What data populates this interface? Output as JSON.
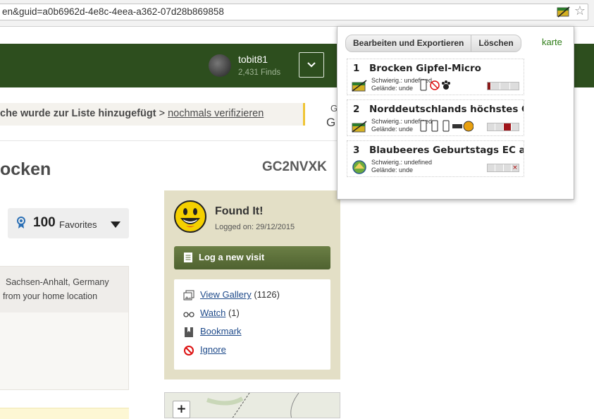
{
  "browser": {
    "url": "en&guid=a0b6962d-4e8c-4eea-a362-07d28b869858"
  },
  "header": {
    "username": "tobit81",
    "finds": "2,431 Finds"
  },
  "notice": {
    "text": "che wurde zur Liste hinzugefügt",
    "separator": " > ",
    "link": "nochmals verifizieren"
  },
  "fragments": {
    "g1": "G",
    "g2": "G"
  },
  "cache": {
    "title": "ocken",
    "code": "GC2NVXK"
  },
  "favorites": {
    "count": "100",
    "label": "Favorites"
  },
  "location": {
    "line1": "Sachsen-Anhalt, Germany",
    "line2": "from your home location"
  },
  "log": {
    "status": "Found It!",
    "logged_on": "Logged on: 29/12/2015",
    "log_button": "Log a new visit",
    "actions": [
      {
        "label": "View Gallery",
        "suffix": " (1126)",
        "icon": "gallery-icon"
      },
      {
        "label": "Watch",
        "suffix": " (1)",
        "icon": "glasses-icon"
      },
      {
        "label": "Bookmark",
        "suffix": "",
        "icon": "bookmark-icon"
      },
      {
        "label": "Ignore",
        "suffix": "",
        "icon": "ignore-icon"
      }
    ]
  },
  "map": {
    "zoom_in": "+"
  },
  "popup": {
    "buttons": [
      "Bearbeiten und Exportieren",
      "Löschen"
    ],
    "map_link": "karte",
    "items": [
      {
        "num": "1",
        "name": "Brocken Gipfel-Micro",
        "difficulty": "Schwierig.: undefined",
        "terrain": "Gelände: unde",
        "type": "traditional",
        "bar_state": "low",
        "bar_color": "#8b1a1a"
      },
      {
        "num": "2",
        "name": "Norddeutschlands höchstes Gip",
        "difficulty": "Schwierig.: undefined",
        "terrain": "Gelände: unde",
        "type": "traditional",
        "bar_state": "high",
        "bar_color": "#a0151a"
      },
      {
        "num": "3",
        "name": "Blaubeeres Geburtstags EC am I",
        "difficulty": "Schwierig.: undefined",
        "terrain": "Gelände: unde",
        "type": "earthcache",
        "bar_state": "x",
        "bar_color": "#bbbbbb"
      }
    ]
  },
  "colors": {
    "header_bg": "#2d4e1e",
    "notice_accent": "#f0c535",
    "log_panel_bg": "#e3dfc6",
    "log_button": "#5c6f3a",
    "link": "#1e4a8a",
    "karte_link": "#2f7d18"
  }
}
